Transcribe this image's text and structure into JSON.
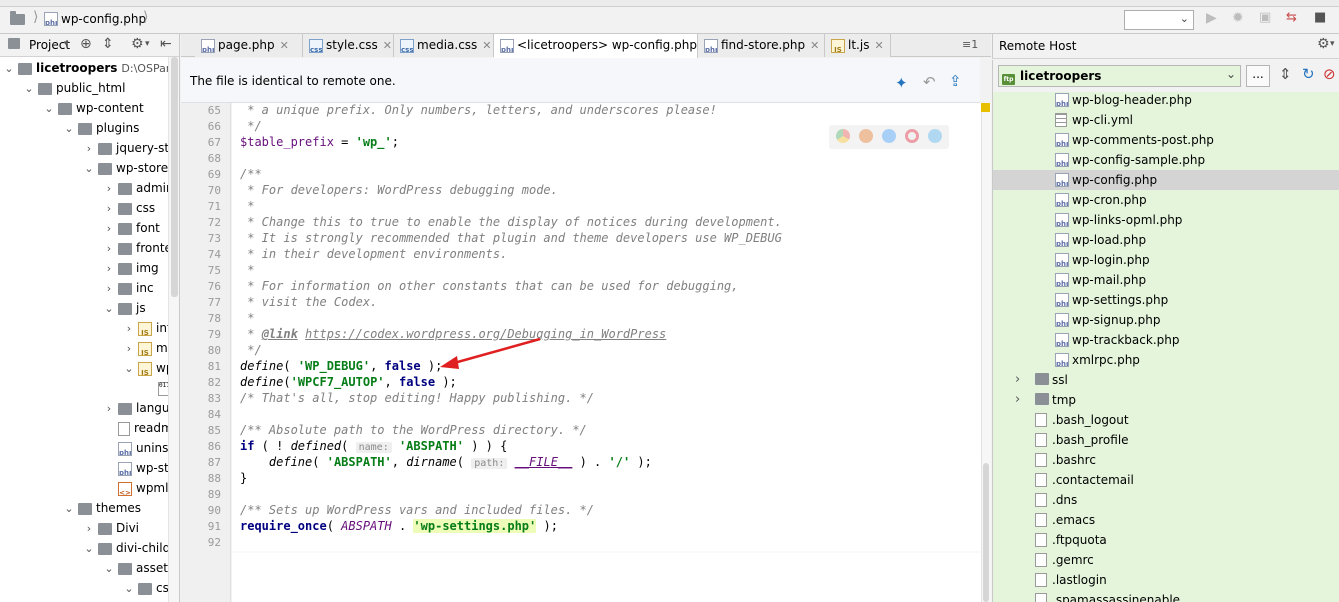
{
  "breadcrumb": {
    "file": "wp-config.php"
  },
  "project_panel": {
    "title": "Project",
    "tree": [
      {
        "label": "licetroopers",
        "path_hint": "D:\\OSPanel\\d",
        "bold": true,
        "depth": 0,
        "chev": "v",
        "icon": "folder"
      },
      {
        "label": "public_html",
        "depth": 1,
        "chev": "v",
        "icon": "folder"
      },
      {
        "label": "wp-content",
        "depth": 2,
        "chev": "v",
        "icon": "folder"
      },
      {
        "label": "plugins",
        "depth": 3,
        "chev": "v",
        "icon": "folder"
      },
      {
        "label": "jquery-stor",
        "depth": 4,
        "chev": ">",
        "icon": "folder"
      },
      {
        "label": "wp-store-lo",
        "depth": 4,
        "chev": "v",
        "icon": "folder"
      },
      {
        "label": "admin",
        "depth": 5,
        "chev": ">",
        "icon": "folder"
      },
      {
        "label": "css",
        "depth": 5,
        "chev": ">",
        "icon": "folder"
      },
      {
        "label": "font",
        "depth": 5,
        "chev": ">",
        "icon": "folder"
      },
      {
        "label": "fronten",
        "depth": 5,
        "chev": ">",
        "icon": "folder"
      },
      {
        "label": "img",
        "depth": 5,
        "chev": ">",
        "icon": "folder"
      },
      {
        "label": "inc",
        "depth": 5,
        "chev": ">",
        "icon": "folder"
      },
      {
        "label": "js",
        "depth": 5,
        "chev": "v",
        "icon": "folder"
      },
      {
        "label": "info",
        "depth": 6,
        "chev": ">",
        "icon": "js"
      },
      {
        "label": "mar",
        "depth": 6,
        "chev": ">",
        "icon": "js"
      },
      {
        "label": "wps",
        "depth": 6,
        "chev": "v",
        "icon": "js"
      },
      {
        "label": "",
        "depth": 7,
        "chev": "",
        "icon": "binary"
      },
      {
        "label": "languag",
        "depth": 5,
        "chev": ">",
        "icon": "folder"
      },
      {
        "label": "readme",
        "depth": 5,
        "chev": "",
        "icon": "doc"
      },
      {
        "label": "uninsta",
        "depth": 5,
        "chev": "",
        "icon": "php"
      },
      {
        "label": "wp-stor",
        "depth": 5,
        "chev": "",
        "icon": "php"
      },
      {
        "label": "wpml-c",
        "depth": 5,
        "chev": "",
        "icon": "xml"
      },
      {
        "label": "themes",
        "depth": 3,
        "chev": "v",
        "icon": "folder"
      },
      {
        "label": "Divi",
        "depth": 4,
        "chev": ">",
        "icon": "folder"
      },
      {
        "label": "divi-child",
        "depth": 4,
        "chev": "v",
        "icon": "folder"
      },
      {
        "label": "assets",
        "depth": 5,
        "chev": "v",
        "icon": "folder"
      },
      {
        "label": "css",
        "depth": 6,
        "chev": "v",
        "icon": "folder"
      }
    ]
  },
  "tabs": [
    {
      "label": "page.php",
      "icon": "php",
      "active": false
    },
    {
      "label": "style.css",
      "icon": "css",
      "active": false
    },
    {
      "label": "media.css",
      "icon": "css",
      "active": false
    },
    {
      "label": "<licetroopers> wp-config.php",
      "icon": "php",
      "active": true
    },
    {
      "label": "find-store.php",
      "icon": "php",
      "active": false
    },
    {
      "label": "lt.js",
      "icon": "js",
      "active": false
    }
  ],
  "tab_overflow": "≡1",
  "notice": "The file is identical to remote one.",
  "code": {
    "lines": [
      {
        "n": "65",
        "html": "<span class=\"cm\"> * a unique prefix. Only numbers, letters, and underscores please!</span>"
      },
      {
        "n": "66",
        "html": "<span class=\"cm\"> */</span>"
      },
      {
        "n": "67",
        "html": "<span class=\"var\">$table_prefix</span> = <span class=\"str\">'wp_'</span>;"
      },
      {
        "n": "68",
        "html": ""
      },
      {
        "n": "69",
        "html": "<span class=\"cm\">/**</span>"
      },
      {
        "n": "70",
        "html": "<span class=\"cm\"> * For developers: WordPress debugging mode.</span>"
      },
      {
        "n": "71",
        "html": "<span class=\"cm\"> *</span>"
      },
      {
        "n": "72",
        "html": "<span class=\"cm\"> * Change this to true to enable the display of notices during development.</span>"
      },
      {
        "n": "73",
        "html": "<span class=\"cm\"> * It is strongly recommended that plugin and theme developers use WP_DEBUG</span>"
      },
      {
        "n": "74",
        "html": "<span class=\"cm\"> * in their development environments.</span>"
      },
      {
        "n": "75",
        "html": "<span class=\"cm\"> *</span>"
      },
      {
        "n": "76",
        "html": "<span class=\"cm\"> * For information on other constants that can be used for debugging,</span>"
      },
      {
        "n": "77",
        "html": "<span class=\"cm\"> * visit the Codex.</span>"
      },
      {
        "n": "78",
        "html": "<span class=\"cm\"> *</span>"
      },
      {
        "n": "79",
        "html": "<span class=\"cm\"> * <b><u>@link</u></b> <u>https://codex.wordpress.org/Debugging_in_WordPress</u></span>"
      },
      {
        "n": "80",
        "html": "<span class=\"cm\"> */</span>"
      },
      {
        "n": "81",
        "html": "<i>define</i>( <span class=\"str\">'WP_DEBUG'</span>, <span class=\"kw\">false</span> );"
      },
      {
        "n": "82",
        "html": "<i>define</i>(<span class=\"str\">'WPCF7_AUTOP'</span>, <span class=\"kw\">false</span> );"
      },
      {
        "n": "83",
        "html": "<span class=\"cm\">/* That's all, stop editing! Happy publishing. */</span>"
      },
      {
        "n": "84",
        "html": ""
      },
      {
        "n": "85",
        "html": "<span class=\"cm\">/** Absolute path to the WordPress directory. */</span>"
      },
      {
        "n": "86",
        "html": "<span class=\"kw\">if</span> ( ! <i>defined</i>( <span class=\"hint\">name:</span> <span class=\"str\">'ABSPATH'</span> ) ) {"
      },
      {
        "n": "87",
        "html": "    <i>define</i>( <span class=\"str\">'ABSPATH'</span>, <i>dirname</i>( <span class=\"hint\">path:</span> <span class=\"cnst\"><u>__FILE__</u></span> ) . <span class=\"str\">'/'</span> );"
      },
      {
        "n": "88",
        "html": "}"
      },
      {
        "n": "89",
        "html": ""
      },
      {
        "n": "90",
        "html": "<span class=\"cm\">/** Sets up WordPress vars and included files. */</span>"
      },
      {
        "n": "91",
        "html": "<span class=\"kw\">require_once</span>( <span class=\"cnst\">ABSPATH</span> . <span class=\"str\" style=\"background:#edfcb8\">'wp-settings.php'</span> );"
      },
      {
        "n": "92",
        "html": ""
      }
    ]
  },
  "remote": {
    "title": "Remote Host",
    "server": "licetroopers",
    "more_button": "...",
    "files": [
      {
        "label": "wp-blog-header.php",
        "icon": "php",
        "indent": 62
      },
      {
        "label": "wp-cli.yml",
        "icon": "grid",
        "indent": 62
      },
      {
        "label": "wp-comments-post.php",
        "icon": "php",
        "indent": 62
      },
      {
        "label": "wp-config-sample.php",
        "icon": "php",
        "indent": 62
      },
      {
        "label": "wp-config.php",
        "icon": "php",
        "indent": 62,
        "selected": true
      },
      {
        "label": "wp-cron.php",
        "icon": "php",
        "indent": 62
      },
      {
        "label": "wp-links-opml.php",
        "icon": "php",
        "indent": 62
      },
      {
        "label": "wp-load.php",
        "icon": "php",
        "indent": 62
      },
      {
        "label": "wp-login.php",
        "icon": "php",
        "indent": 62
      },
      {
        "label": "wp-mail.php",
        "icon": "php",
        "indent": 62
      },
      {
        "label": "wp-settings.php",
        "icon": "php",
        "indent": 62
      },
      {
        "label": "wp-signup.php",
        "icon": "php",
        "indent": 62
      },
      {
        "label": "wp-trackback.php",
        "icon": "php",
        "indent": 62
      },
      {
        "label": "xmlrpc.php",
        "icon": "php",
        "indent": 62
      },
      {
        "label": "ssl",
        "icon": "folder",
        "indent": 42,
        "chev": ">"
      },
      {
        "label": "tmp",
        "icon": "folder",
        "indent": 42,
        "chev": ">"
      },
      {
        "label": ".bash_logout",
        "icon": "doc",
        "indent": 42
      },
      {
        "label": ".bash_profile",
        "icon": "doc",
        "indent": 42
      },
      {
        "label": ".bashrc",
        "icon": "doc",
        "indent": 42
      },
      {
        "label": ".contactemail",
        "icon": "doc",
        "indent": 42
      },
      {
        "label": ".dns",
        "icon": "doc",
        "indent": 42
      },
      {
        "label": ".emacs",
        "icon": "doc",
        "indent": 42
      },
      {
        "label": ".ftpquota",
        "icon": "doc",
        "indent": 42
      },
      {
        "label": ".gemrc",
        "icon": "doc",
        "indent": 42
      },
      {
        "label": ".lastlogin",
        "icon": "doc",
        "indent": 42
      },
      {
        "label": ".spamassassinenable",
        "icon": "doc",
        "indent": 42
      }
    ]
  },
  "colors": {
    "accent": "#2675bf",
    "remote_bg": "#e5f5dc",
    "arrow": "#e02020"
  }
}
